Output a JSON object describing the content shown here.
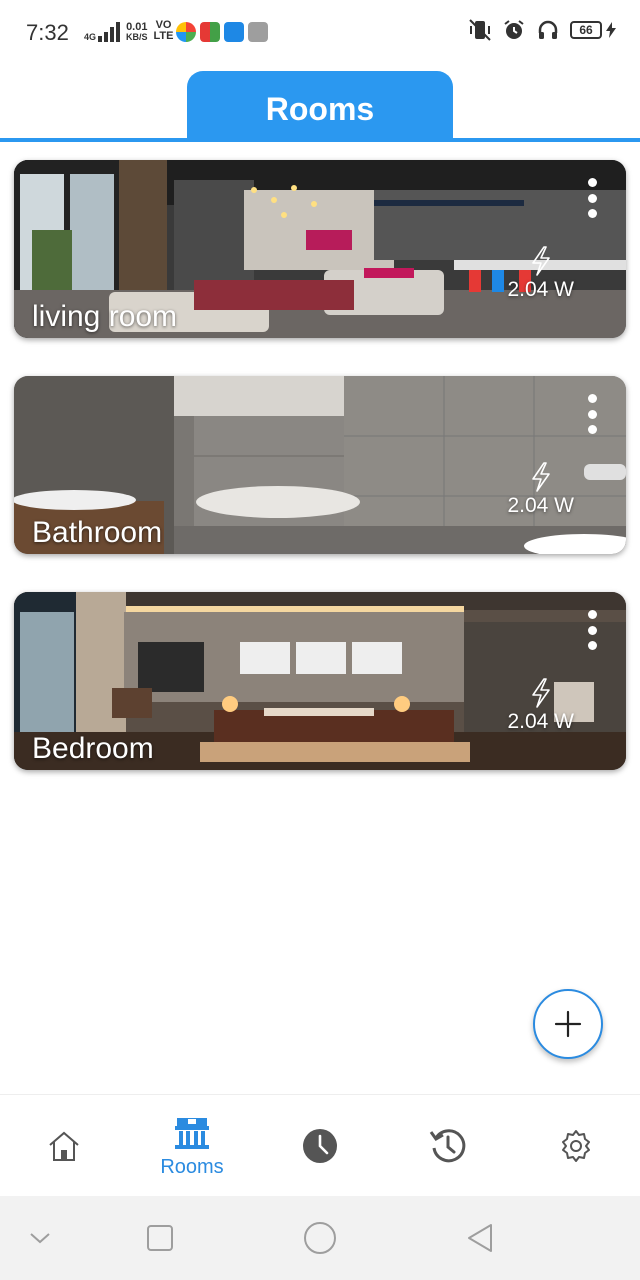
{
  "status_bar": {
    "time": "7:32",
    "network_type": "4G",
    "data_speed_value": "0.01",
    "data_speed_unit": "KB/S",
    "volte_top": "VO",
    "volte_bottom": "LTE",
    "battery_level": "66"
  },
  "header": {
    "title": "Rooms"
  },
  "rooms": [
    {
      "name": "living room",
      "power": "2.04 W"
    },
    {
      "name": "Bathroom",
      "power": "2.04 W"
    },
    {
      "name": "Bedroom",
      "power": "2.04 W"
    }
  ],
  "bottom_nav": {
    "items": [
      {
        "icon": "home-icon",
        "label": ""
      },
      {
        "icon": "rooms-building-icon",
        "label": "Rooms",
        "active": true
      },
      {
        "icon": "clock-icon",
        "label": ""
      },
      {
        "icon": "history-icon",
        "label": ""
      },
      {
        "icon": "gear-icon",
        "label": ""
      }
    ]
  },
  "colors": {
    "accent": "#2b98f0",
    "active_nav": "#2b8be0",
    "inactive_icon": "#555555"
  }
}
